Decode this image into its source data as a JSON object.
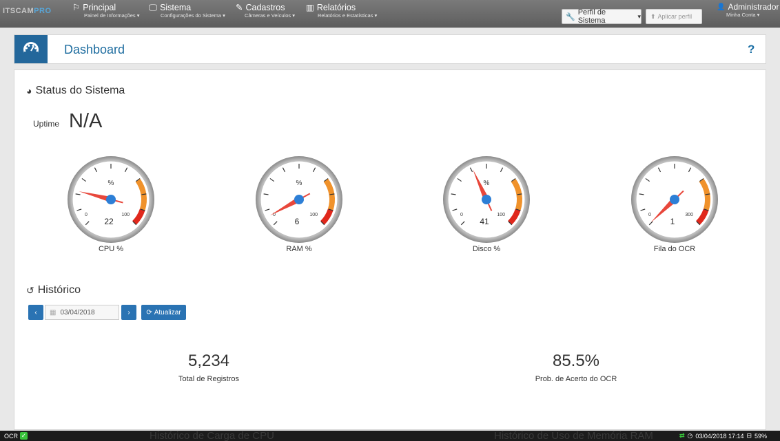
{
  "nav": {
    "brand_prefix": "ITSCAM",
    "brand_suffix": "PRO",
    "items": [
      {
        "title": "Principal",
        "subtitle": "Painel de Informações"
      },
      {
        "title": "Sistema",
        "subtitle": "Configurações do Sistema"
      },
      {
        "title": "Cadastros",
        "subtitle": "Câmeras e Veículos"
      },
      {
        "title": "Relatórios",
        "subtitle": "Relatórios e Estatísticas"
      }
    ],
    "profile_label": "Perfil de Sistema",
    "apply_label": "Aplicar perfil",
    "account_title": "Administrador",
    "account_subtitle": "Minha Conta"
  },
  "header": {
    "title": "Dashboard",
    "help": "?"
  },
  "status": {
    "title": "Status do Sistema",
    "uptime_label": "Uptime",
    "uptime_value": "N/A"
  },
  "gauges": [
    {
      "label": "CPU %",
      "value": 22,
      "max": 100,
      "unit": "%",
      "min_label": "0",
      "max_label": "100",
      "value_text": "22"
    },
    {
      "label": "RAM %",
      "value": 6,
      "max": 100,
      "unit": "%",
      "min_label": "0",
      "max_label": "100",
      "value_text": "6"
    },
    {
      "label": "Disco %",
      "value": 41,
      "max": 100,
      "unit": "%",
      "min_label": "0",
      "max_label": "100",
      "value_text": "41"
    },
    {
      "label": "Fila do OCR",
      "value": 1,
      "max": 300,
      "unit": "",
      "min_label": "0",
      "max_label": "300",
      "value_text": "1"
    }
  ],
  "history": {
    "title": "Histórico",
    "date": "03/04/2018",
    "refresh_label": "Atualizar",
    "prev": "‹",
    "next": "›"
  },
  "stats": [
    {
      "value": "5,234",
      "label": "Total de Registros"
    },
    {
      "value": "85.5%",
      "label": "Prob. de Acerto do OCR"
    }
  ],
  "statusbar": {
    "ocr_label": "OCR",
    "cpu_chart_title": "Histórico de Carga de CPU",
    "ram_chart_title": "Histórico de Uso de Memória RAM",
    "datetime": "03/04/2018 17:14",
    "disk": "59%"
  },
  "colors": {
    "accent": "#23679b",
    "gauge_orange": "#f0922b",
    "gauge_red": "#e0281c",
    "needle": "#e8473b",
    "hub": "#2d7fd6"
  }
}
